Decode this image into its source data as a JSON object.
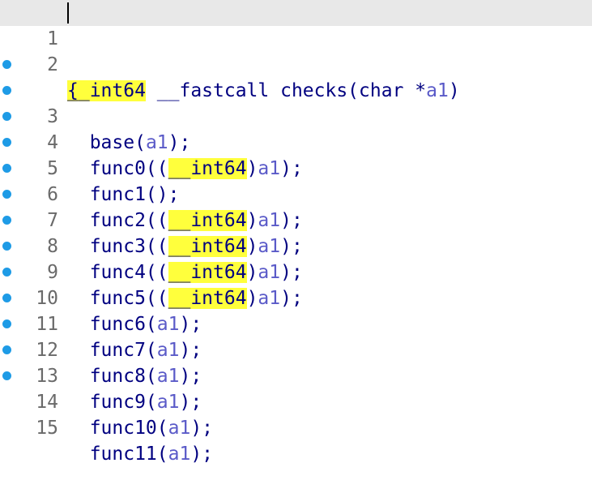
{
  "editor": {
    "lines": [
      {
        "num": "1",
        "parts": [
          "__int64",
          " __fastcall checks(",
          "char",
          " *",
          "a1",
          ")"
        ]
      },
      {
        "num": "2",
        "text": "{"
      },
      {
        "num": "3",
        "parts": [
          "  base(",
          "a1",
          ");"
        ]
      },
      {
        "num": "4",
        "parts": [
          "  func0((",
          "__int64",
          ")",
          "a1",
          ");"
        ]
      },
      {
        "num": "5",
        "parts": [
          "  func1();"
        ]
      },
      {
        "num": "6",
        "parts": [
          "  func2((",
          "__int64",
          ")",
          "a1",
          ");"
        ]
      },
      {
        "num": "7",
        "parts": [
          "  func3((",
          "__int64",
          ")",
          "a1",
          ");"
        ]
      },
      {
        "num": "8",
        "parts": [
          "  func4((",
          "__int64",
          ")",
          "a1",
          ");"
        ]
      },
      {
        "num": "9",
        "parts": [
          "  func5((",
          "__int64",
          ")",
          "a1",
          ");"
        ]
      },
      {
        "num": "10",
        "parts": [
          "  func6(",
          "a1",
          ");"
        ]
      },
      {
        "num": "11",
        "parts": [
          "  func7(",
          "a1",
          ");"
        ]
      },
      {
        "num": "12",
        "parts": [
          "  func8(",
          "a1",
          ");"
        ]
      },
      {
        "num": "13",
        "parts": [
          "  func9(",
          "a1",
          ");"
        ]
      },
      {
        "num": "14",
        "parts": [
          "  func10(",
          "a1",
          ");"
        ]
      },
      {
        "num": "15",
        "parts": [
          "  func11(",
          "a1",
          ");"
        ]
      }
    ]
  },
  "colors": {
    "keyword": "#000080",
    "variable": "#5a5ac8",
    "highlight": "#ffff3c",
    "breakpoint": "#1e9be6",
    "current_line": "#e8e8e8"
  }
}
